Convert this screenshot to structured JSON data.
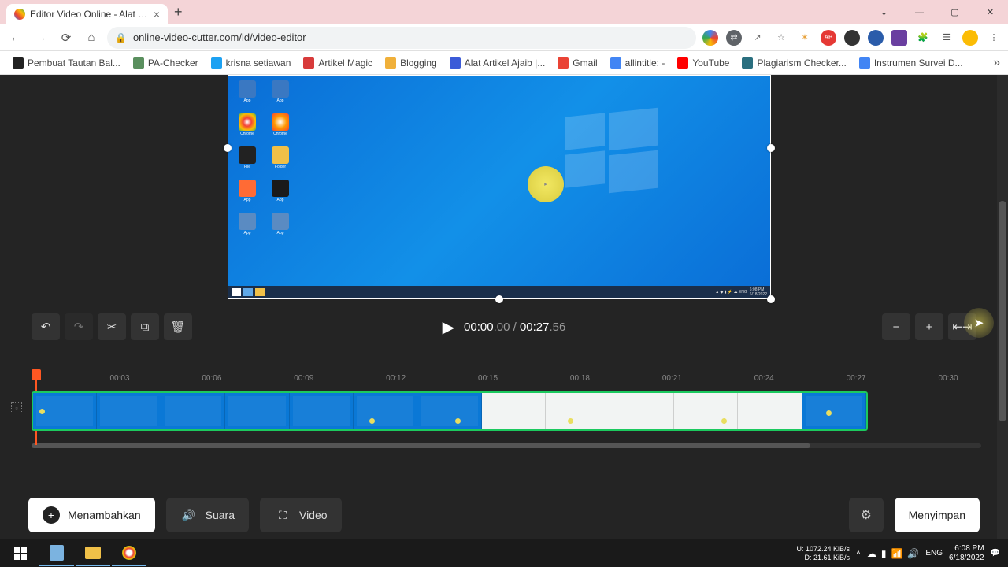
{
  "browser": {
    "tab_title": "Editor Video Online - Alat Penge",
    "url": "online-video-cutter.com/id/video-editor",
    "bookmarks": [
      {
        "label": "Pembuat Tautan Bal...",
        "color": "#222"
      },
      {
        "label": "PA-Checker",
        "color": "#5a8f5e"
      },
      {
        "label": "krisna setiawan",
        "color": "#1da1f2"
      },
      {
        "label": "Artikel Magic",
        "color": "#d83b3b"
      },
      {
        "label": "Blogging",
        "color": "#f0b03a"
      },
      {
        "label": "Alat Artikel Ajaib |...",
        "color": "#3b5bd8"
      },
      {
        "label": "Gmail",
        "color": "#ea4335"
      },
      {
        "label": "allintitle: -",
        "color": "#4285f4"
      },
      {
        "label": "YouTube",
        "color": "#ff0000"
      },
      {
        "label": "Plagiarism Checker...",
        "color": "#2a6f7f"
      },
      {
        "label": "Instrumen Survei D...",
        "color": "#4285f4"
      }
    ]
  },
  "transport": {
    "current": "00:00",
    "current_frac": ".00",
    "sep": " / ",
    "total": "00:27",
    "total_frac": ".56"
  },
  "ruler": {
    "ticks": [
      "00:03",
      "00:06",
      "00:09",
      "00:12",
      "00:15",
      "00:18",
      "00:21",
      "00:24",
      "00:27",
      "00:30"
    ]
  },
  "bottom": {
    "add": "Menambahkan",
    "sound": "Suara",
    "video": "Video",
    "save": "Menyimpan"
  },
  "taskbar": {
    "net_up": "U:    1072.24 KiB/s",
    "net_down": "D:       21.61 KiB/s",
    "lang": "ENG",
    "time": "6:08 PM",
    "date": "6/18/2022"
  },
  "thumbs": [
    {
      "light": false,
      "dot": "left:8px;top:20px"
    },
    {
      "light": false,
      "dot": null
    },
    {
      "light": false,
      "dot": null
    },
    {
      "light": false,
      "dot": null
    },
    {
      "light": false,
      "dot": null
    },
    {
      "light": false,
      "dot": "left:20px;top:32px"
    },
    {
      "light": false,
      "dot": "left:48px;top:32px"
    },
    {
      "light": true,
      "dot": null
    },
    {
      "light": true,
      "dot": "left:28px;top:32px"
    },
    {
      "light": true,
      "dot": null
    },
    {
      "light": true,
      "dot": "left:60px;top:32px"
    },
    {
      "light": true,
      "dot": null
    },
    {
      "light": false,
      "dot": "left:30px;top:22px"
    }
  ]
}
